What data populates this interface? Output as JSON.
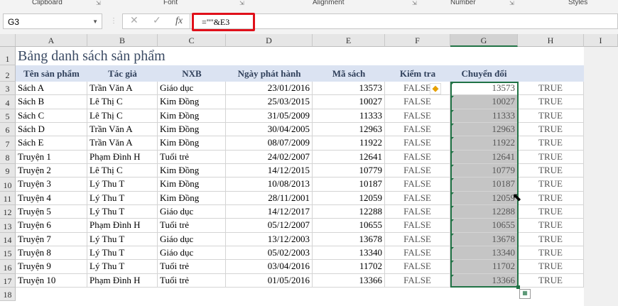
{
  "ribbon": {
    "groups": [
      "Clipboard",
      "Font",
      "Alignment",
      "Number",
      "Styles"
    ]
  },
  "formula_bar": {
    "name_box": "G3",
    "cancel": "✕",
    "enter": "✓",
    "fx": "fx",
    "formula": "=\"\"&E3"
  },
  "columns": [
    "A",
    "B",
    "C",
    "D",
    "E",
    "F",
    "G",
    "H",
    "I"
  ],
  "selected_column": "G",
  "selected_cell": "G3",
  "sheet": {
    "title": "Bảng danh sách sản phẩm",
    "headers": [
      "Tên sản phẩm",
      "Tác giả",
      "NXB",
      "Ngày phát hành",
      "Mã sách",
      "Kiểm tra",
      "Chuyển đổi",
      ""
    ],
    "rows": [
      [
        "Sách A",
        "Trần Văn A",
        "Giáo dục",
        "23/01/2016",
        "13573",
        "FALSE",
        "13573",
        "TRUE"
      ],
      [
        "Sách B",
        "Lê Thị C",
        "Kim Đồng",
        "25/03/2015",
        "10027",
        "FALSE",
        "10027",
        "TRUE"
      ],
      [
        "Sách C",
        "Lê Thị C",
        "Kim Đồng",
        "31/05/2009",
        "11333",
        "FALSE",
        "11333",
        "TRUE"
      ],
      [
        "Sách D",
        "Trần Văn A",
        "Kim Đồng",
        "30/04/2005",
        "12963",
        "FALSE",
        "12963",
        "TRUE"
      ],
      [
        "Sách E",
        "Trần Văn A",
        "Kim Đồng",
        "08/07/2009",
        "11922",
        "FALSE",
        "11922",
        "TRUE"
      ],
      [
        "Truyện 1",
        "Phạm Đình H",
        "Tuổi trẻ",
        "24/02/2007",
        "12641",
        "FALSE",
        "12641",
        "TRUE"
      ],
      [
        "Truyện 2",
        "Lê Thị C",
        "Kim Đồng",
        "14/12/2015",
        "10779",
        "FALSE",
        "10779",
        "TRUE"
      ],
      [
        "Truyện 3",
        "Lý Thu T",
        "Kim Đồng",
        "10/08/2013",
        "10187",
        "FALSE",
        "10187",
        "TRUE"
      ],
      [
        "Truyện 4",
        "Lý Thu T",
        "Kim Đồng",
        "28/11/2001",
        "12059",
        "FALSE",
        "12059",
        "TRUE"
      ],
      [
        "Truyện 5",
        "Lý Thu T",
        "Giáo dục",
        "14/12/2017",
        "12288",
        "FALSE",
        "12288",
        "TRUE"
      ],
      [
        "Truyện 6",
        "Phạm Đình H",
        "Tuổi trẻ",
        "05/12/2007",
        "10655",
        "FALSE",
        "10655",
        "TRUE"
      ],
      [
        "Truyện 7",
        "Lý Thu T",
        "Giáo dục",
        "13/12/2003",
        "13678",
        "FALSE",
        "13678",
        "TRUE"
      ],
      [
        "Truyện 8",
        "Lý Thu T",
        "Giáo dục",
        "05/02/2003",
        "13340",
        "FALSE",
        "13340",
        "TRUE"
      ],
      [
        "Truyện 9",
        "Lý Thu T",
        "Tuổi trẻ",
        "03/04/2016",
        "11702",
        "FALSE",
        "11702",
        "TRUE"
      ],
      [
        "Truyện 10",
        "Phạm Đình H",
        "Tuổi trẻ",
        "01/05/2016",
        "13366",
        "FALSE",
        "13366",
        "TRUE"
      ]
    ]
  },
  "row_numbers": [
    "1",
    "2",
    "3",
    "4",
    "5",
    "6",
    "7",
    "8",
    "9",
    "10",
    "11",
    "12",
    "13",
    "14",
    "15",
    "16",
    "17",
    "18"
  ]
}
